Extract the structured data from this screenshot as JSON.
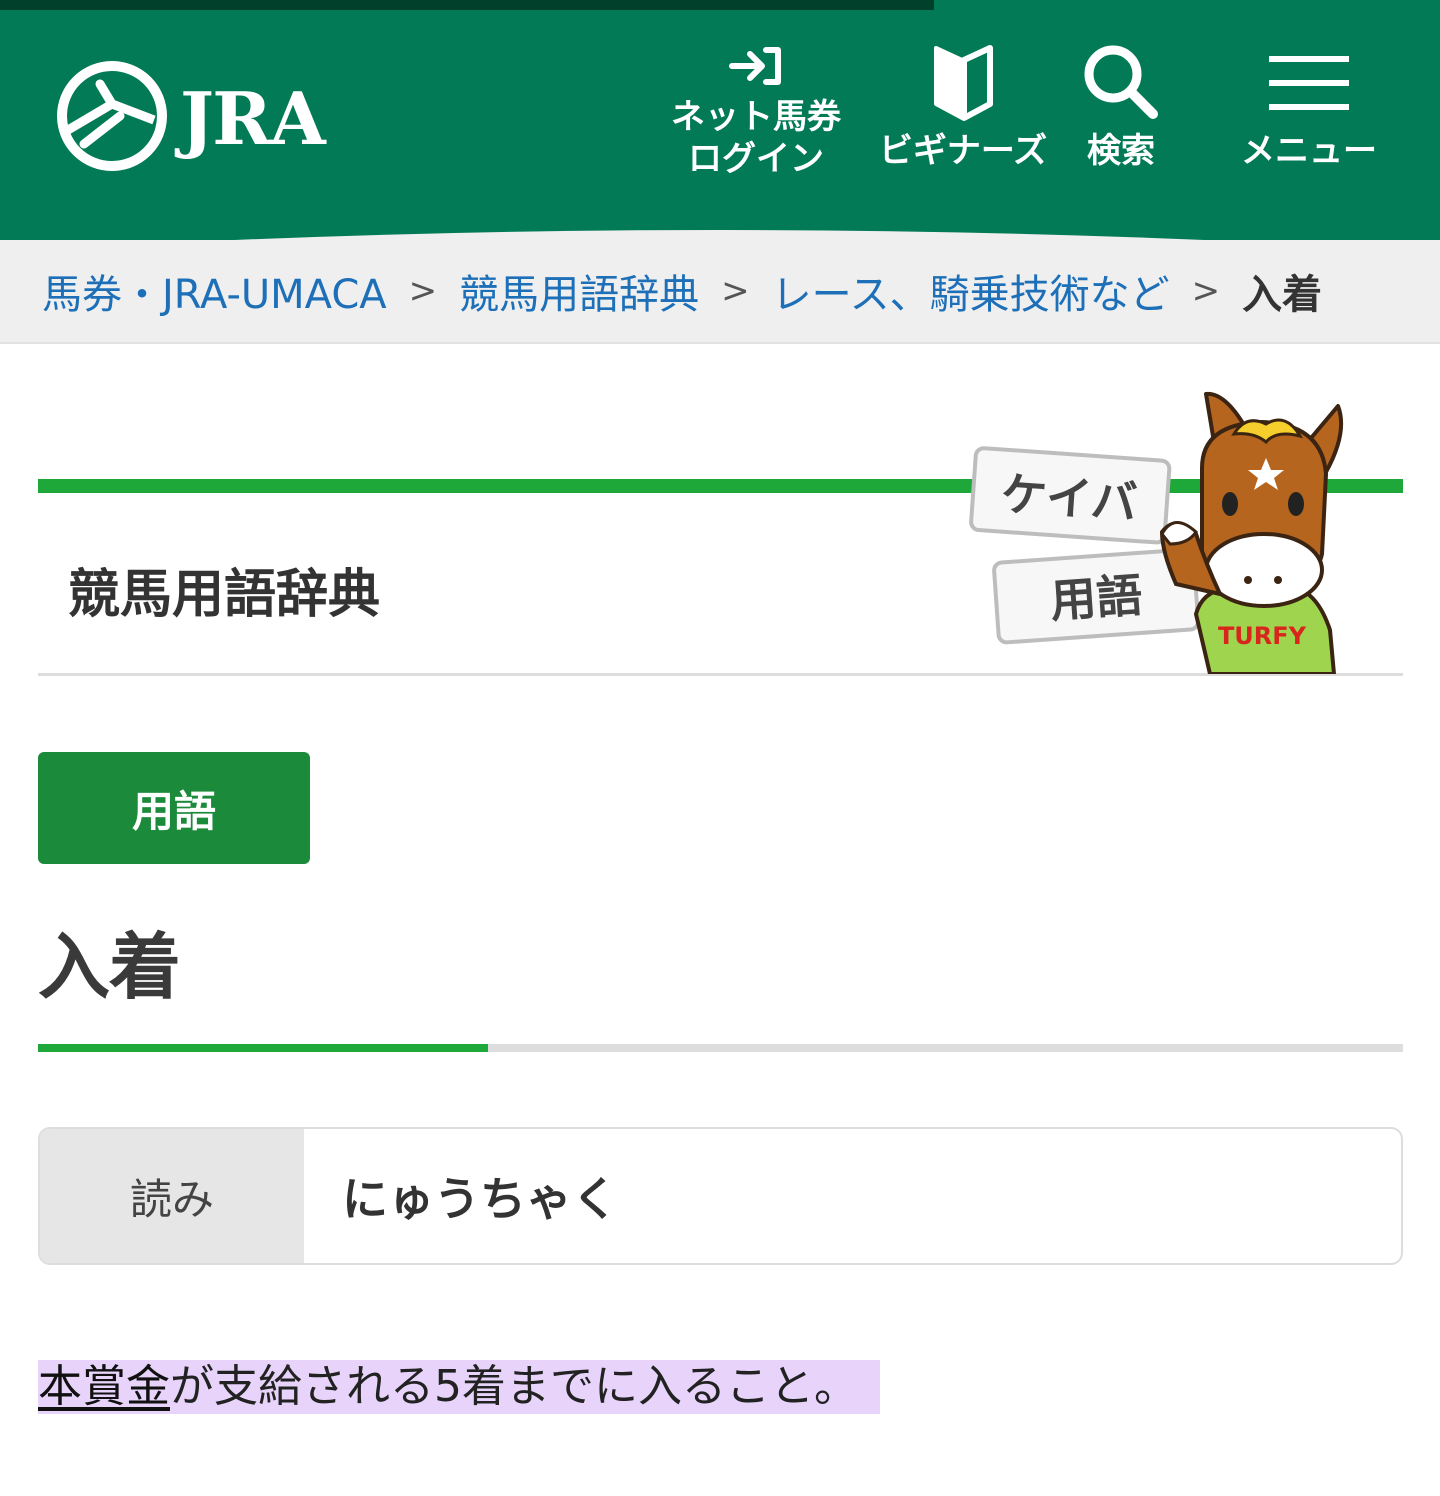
{
  "header": {
    "logo_text": "JRA",
    "nav": {
      "login_line1": "ネット馬券",
      "login_line2": "ログイン",
      "beginners": "ビギナーズ",
      "search": "検索",
      "menu": "メニュー"
    }
  },
  "breadcrumb": {
    "items": [
      "馬券・JRA-UMACA",
      "競馬用語辞典",
      "レース、騎乗技術など"
    ],
    "separator": ">",
    "current": "入着"
  },
  "dictionary": {
    "title": "競馬用語辞典",
    "mascot": {
      "sign_top": "ケイバ",
      "sign_bottom": "用語",
      "shirt": "TURFY"
    }
  },
  "term": {
    "badge": "用語",
    "name": "入着",
    "reading_label": "読み",
    "reading_value": "にゅうちゃく",
    "definition_link": "本賞金",
    "definition_rest": "が支給される5着までに入ること。"
  },
  "colors": {
    "header_green": "#027a55",
    "accent_green": "#1fa83a",
    "badge_green": "#1c8a3b",
    "link_blue": "#1d6fb8",
    "highlight_purple": "#e8d4fb"
  }
}
